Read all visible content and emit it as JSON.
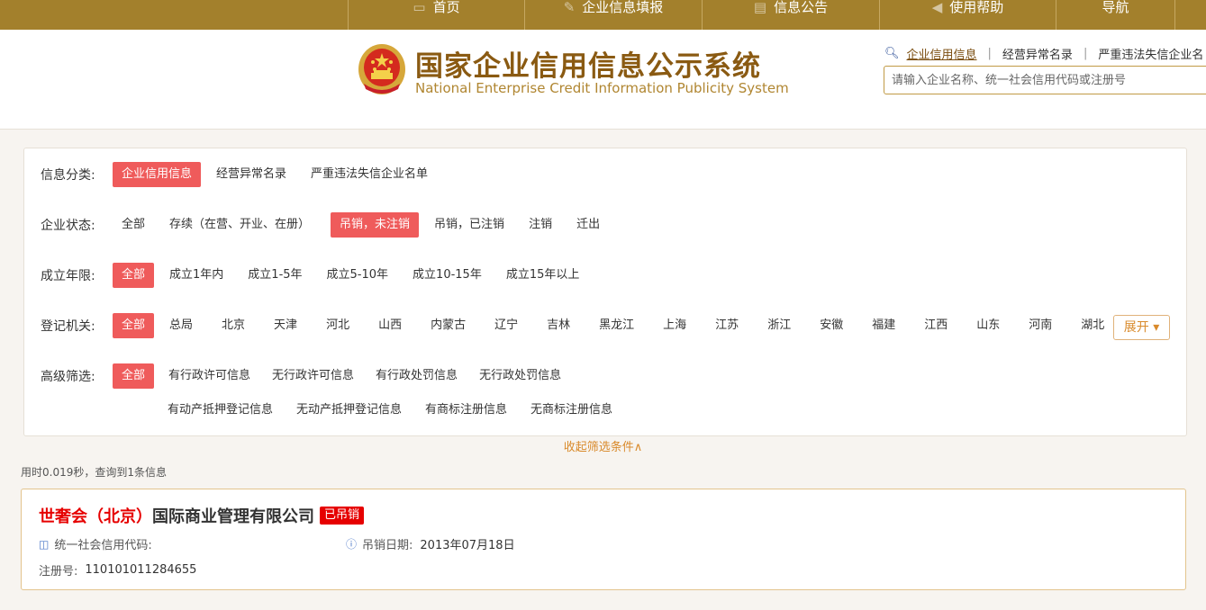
{
  "nav": {
    "items": [
      {
        "label": "首页",
        "icon": "monitor-icon"
      },
      {
        "label": "企业信息填报",
        "icon": "pen-icon"
      },
      {
        "label": "信息公告",
        "icon": "document-icon"
      },
      {
        "label": "使用帮助",
        "icon": "speaker-icon"
      },
      {
        "label": "导航",
        "icon": ""
      }
    ]
  },
  "header": {
    "title_cn": "国家企业信用信息公示系统",
    "title_en": "National Enterprise Credit Information Publicity System",
    "quick_links": [
      "企业信用信息",
      "经营异常名录",
      "严重违法失信企业名"
    ],
    "search_placeholder": "请输入企业名称、统一社会信用代码或注册号"
  },
  "filters": {
    "category": {
      "label": "信息分类:",
      "options": [
        "企业信用信息",
        "经营异常名录",
        "严重违法失信企业名单"
      ],
      "selected": "企业信用信息"
    },
    "status": {
      "label": "企业状态:",
      "options": [
        "全部",
        "存续（在营、开业、在册）",
        "吊销，未注销",
        "吊销，已注销",
        "注销",
        "迁出"
      ],
      "selected": "吊销，未注销"
    },
    "years": {
      "label": "成立年限:",
      "options": [
        "全部",
        "成立1年内",
        "成立1-5年",
        "成立5-10年",
        "成立10-15年",
        "成立15年以上"
      ],
      "selected": "全部"
    },
    "authority": {
      "label": "登记机关:",
      "options": [
        "全部",
        "总局",
        "北京",
        "天津",
        "河北",
        "山西",
        "内蒙古",
        "辽宁",
        "吉林",
        "黑龙江",
        "上海",
        "江苏",
        "浙江",
        "安徽",
        "福建",
        "江西",
        "山东",
        "河南",
        "湖北"
      ],
      "selected": "全部",
      "expand_label": "展开 ▾"
    },
    "advanced": {
      "label": "高级筛选:",
      "options": [
        "全部",
        "有行政许可信息",
        "无行政许可信息",
        "有行政处罚信息",
        "无行政处罚信息"
      ],
      "options_row2": [
        "有动产抵押登记信息",
        "无动产抵押登记信息",
        "有商标注册信息",
        "无商标注册信息"
      ],
      "selected": "全部"
    },
    "collapse_label": "收起筛选条件∧"
  },
  "result_stat": "用时0.019秒，查询到1条信息",
  "result": {
    "name_highlight": "世奢会（北京）",
    "name_rest": "国际商业管理有限公司",
    "badge": "已吊销",
    "credit_code_label": "统一社会信用代码:",
    "revoke_date_label": "吊销日期:",
    "revoke_date": "2013年07月18日",
    "reg_no_label": "注册号:",
    "reg_no": "110101011284655"
  },
  "colors": {
    "nav_bg": "#a3802c",
    "selected_bg": "#ef5b5b",
    "badge_bg": "#e60000",
    "accent_orange": "#d98a2b"
  }
}
